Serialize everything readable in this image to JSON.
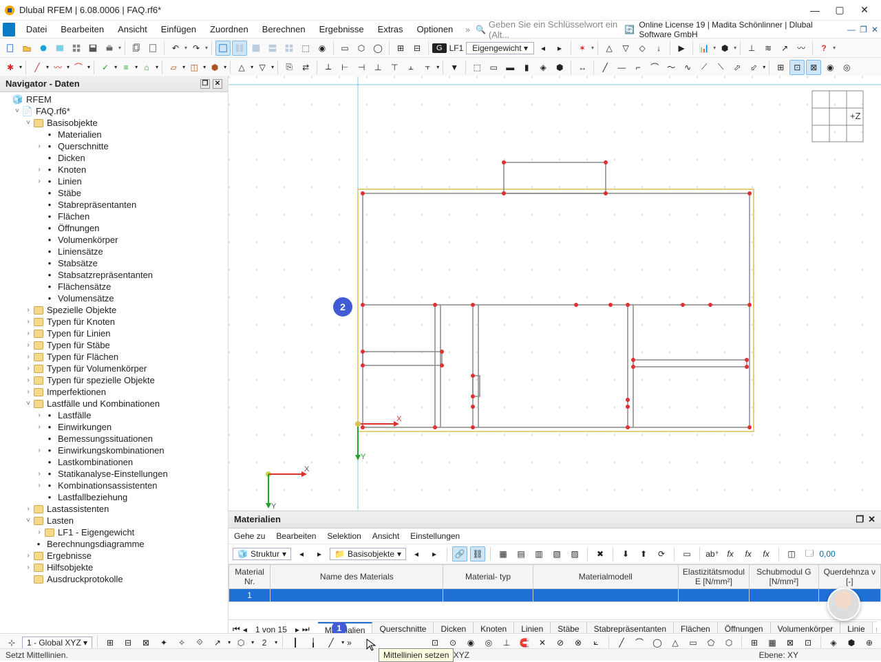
{
  "title": "Dlubal RFEM | 6.08.0006 | FAQ.rf6*",
  "menubar": [
    "Datei",
    "Bearbeiten",
    "Ansicht",
    "Einfügen",
    "Zuordnen",
    "Berechnen",
    "Ergebnisse",
    "Extras",
    "Optionen"
  ],
  "search_placeholder": "Geben Sie ein Schlüsselwort ein (Alt...",
  "license_text": "Online License 19 | Madita Schönlinner | Dlubal Software GmbH",
  "lf": {
    "badge": "G",
    "code": "LF1",
    "label": "Eigengewicht"
  },
  "navigator": {
    "title": "Navigator - Daten",
    "root": "RFEM",
    "file": "FAQ.rf6*",
    "nodes": [
      {
        "label": "Basisobjekte",
        "depth": 2,
        "exp": "v",
        "folder": true
      },
      {
        "label": "Materialien",
        "depth": 3
      },
      {
        "label": "Querschnitte",
        "depth": 3,
        "exp": ">"
      },
      {
        "label": "Dicken",
        "depth": 3
      },
      {
        "label": "Knoten",
        "depth": 3,
        "exp": ">"
      },
      {
        "label": "Linien",
        "depth": 3,
        "exp": ">"
      },
      {
        "label": "Stäbe",
        "depth": 3
      },
      {
        "label": "Stabrepräsentanten",
        "depth": 3
      },
      {
        "label": "Flächen",
        "depth": 3
      },
      {
        "label": "Öffnungen",
        "depth": 3
      },
      {
        "label": "Volumenkörper",
        "depth": 3
      },
      {
        "label": "Liniensätze",
        "depth": 3
      },
      {
        "label": "Stabsätze",
        "depth": 3
      },
      {
        "label": "Stabsatzrepräsentanten",
        "depth": 3
      },
      {
        "label": "Flächensätze",
        "depth": 3
      },
      {
        "label": "Volumensätze",
        "depth": 3
      },
      {
        "label": "Spezielle Objekte",
        "depth": 2,
        "exp": ">",
        "folder": true
      },
      {
        "label": "Typen für Knoten",
        "depth": 2,
        "exp": ">",
        "folder": true
      },
      {
        "label": "Typen für Linien",
        "depth": 2,
        "exp": ">",
        "folder": true
      },
      {
        "label": "Typen für Stäbe",
        "depth": 2,
        "exp": ">",
        "folder": true
      },
      {
        "label": "Typen für Flächen",
        "depth": 2,
        "exp": ">",
        "folder": true
      },
      {
        "label": "Typen für Volumenkörper",
        "depth": 2,
        "exp": ">",
        "folder": true
      },
      {
        "label": "Typen für spezielle Objekte",
        "depth": 2,
        "exp": ">",
        "folder": true
      },
      {
        "label": "Imperfektionen",
        "depth": 2,
        "exp": ">",
        "folder": true
      },
      {
        "label": "Lastfälle und Kombinationen",
        "depth": 2,
        "exp": "v",
        "folder": true
      },
      {
        "label": "Lastfälle",
        "depth": 3,
        "exp": ">"
      },
      {
        "label": "Einwirkungen",
        "depth": 3,
        "exp": ">"
      },
      {
        "label": "Bemessungssituationen",
        "depth": 3
      },
      {
        "label": "Einwirkungskombinationen",
        "depth": 3,
        "exp": ">"
      },
      {
        "label": "Lastkombinationen",
        "depth": 3
      },
      {
        "label": "Statikanalyse-Einstellungen",
        "depth": 3,
        "exp": ">"
      },
      {
        "label": "Kombinationsassistenten",
        "depth": 3,
        "exp": ">"
      },
      {
        "label": "Lastfallbeziehung",
        "depth": 3
      },
      {
        "label": "Lastassistenten",
        "depth": 2,
        "exp": ">",
        "folder": true
      },
      {
        "label": "Lasten",
        "depth": 2,
        "exp": "v",
        "folder": true
      },
      {
        "label": "LF1 - Eigengewicht",
        "depth": 3,
        "exp": ">",
        "folder": true
      },
      {
        "label": "Berechnungsdiagramme",
        "depth": 2
      },
      {
        "label": "Ergebnisse",
        "depth": 2,
        "exp": ">",
        "folder": true
      },
      {
        "label": "Hilfsobjekte",
        "depth": 2,
        "exp": ">",
        "folder": true
      },
      {
        "label": "Ausdruckprotokolle",
        "depth": 2,
        "folder": true
      }
    ]
  },
  "viewcube_label": "+Z",
  "annotations": {
    "a2": "2",
    "a1": "1"
  },
  "axes": {
    "x": "X",
    "y": "Y"
  },
  "datapanel": {
    "title": "Materialien",
    "menu": [
      "Gehe zu",
      "Bearbeiten",
      "Selektion",
      "Ansicht",
      "Einstellungen"
    ],
    "combo_left": "Struktur",
    "combo_right": "Basisobjekte",
    "columns": [
      "Material\nNr.",
      "Name des Materials",
      "Material-\ntyp",
      "Materialmodell",
      "Elastizitätsmodul\nE [N/mm²]",
      "Schubmodul\nG [N/mm²]",
      "Querdehnza\nν [-]"
    ],
    "row_nr": "1",
    "pager": "1 von 15",
    "tabs": [
      "Materialien",
      "Querschnitte",
      "Dicken",
      "Knoten",
      "Linien",
      "Stäbe",
      "Stabrepräsentanten",
      "Flächen",
      "Öffnungen",
      "Volumenkörper",
      "Linie"
    ]
  },
  "bottom_combo": "1 - Global XYZ",
  "status": {
    "left": "Setzt Mittellinien.",
    "center": "KS: Global XYZ",
    "right": "Ebene: XY"
  },
  "tooltip": "Mittellinien setzen"
}
